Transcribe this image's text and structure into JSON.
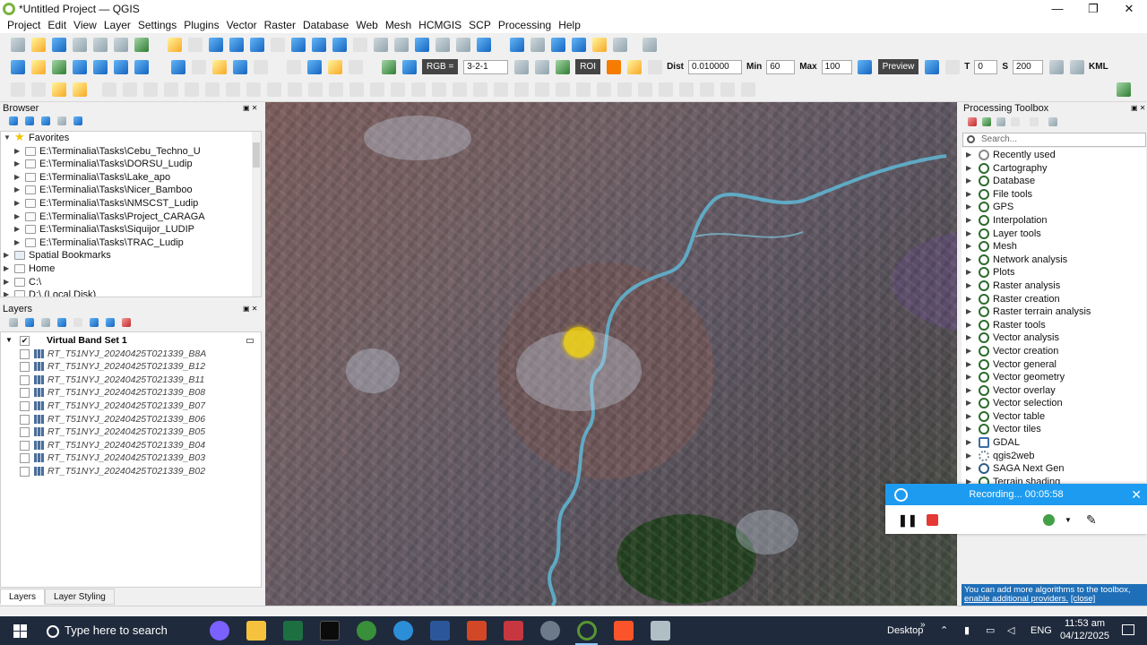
{
  "window": {
    "title": "*Untitled Project — QGIS",
    "minimize": "—",
    "maximize": "❐",
    "close": "✕"
  },
  "menu": [
    "Project",
    "Edit",
    "View",
    "Layer",
    "Settings",
    "Plugins",
    "Vector",
    "Raster",
    "Database",
    "Web",
    "Mesh",
    "HCMGIS",
    "SCP",
    "Processing",
    "Help"
  ],
  "scp_toolbar": {
    "rgb_label": "RGB =",
    "rgb_value": "3-2-1",
    "roi_label": "ROI",
    "dist_label": "Dist",
    "dist_value": "0.010000",
    "min_label": "Min",
    "min_value": "60",
    "max_label": "Max",
    "max_value": "100",
    "preview_label": "Preview",
    "t_label": "T",
    "t_value": "0",
    "s_label": "S",
    "s_value": "200",
    "kml_label": "KML"
  },
  "browser": {
    "title": "Browser",
    "items": [
      {
        "label": "Favorites",
        "level": 0,
        "icon": "star-icon",
        "expanded": true
      },
      {
        "label": "E:\\Terminalia\\Tasks\\Cebu_Techno_U",
        "level": 1,
        "icon": "folder-icon"
      },
      {
        "label": "E:\\Terminalia\\Tasks\\DORSU_Ludip",
        "level": 1,
        "icon": "folder-icon"
      },
      {
        "label": "E:\\Terminalia\\Tasks\\Lake_apo",
        "level": 1,
        "icon": "folder-icon"
      },
      {
        "label": "E:\\Terminalia\\Tasks\\Nicer_Bamboo",
        "level": 1,
        "icon": "folder-icon"
      },
      {
        "label": "E:\\Terminalia\\Tasks\\NMSCST_Ludip",
        "level": 1,
        "icon": "folder-icon"
      },
      {
        "label": "E:\\Terminalia\\Tasks\\Project_CARAGA",
        "level": 1,
        "icon": "folder-icon"
      },
      {
        "label": "E:\\Terminalia\\Tasks\\Siquijor_LUDIP",
        "level": 1,
        "icon": "folder-icon"
      },
      {
        "label": "E:\\Terminalia\\Tasks\\TRAC_Ludip",
        "level": 1,
        "icon": "folder-icon"
      },
      {
        "label": "Spatial Bookmarks",
        "level": 0,
        "icon": "bookmark-icon"
      },
      {
        "label": "Home",
        "level": 0,
        "icon": "home-icon"
      },
      {
        "label": "C:\\",
        "level": 0,
        "icon": "drive-icon"
      },
      {
        "label": "D:\\ (Local Disk)",
        "level": 0,
        "icon": "drive-icon"
      }
    ]
  },
  "layers": {
    "title": "Layers",
    "items": [
      {
        "label": "Virtual Band Set 1",
        "checked": true,
        "group": true
      },
      {
        "label": "RT_T51NYJ_20240425T021339_B8A",
        "checked": false
      },
      {
        "label": "RT_T51NYJ_20240425T021339_B12",
        "checked": false
      },
      {
        "label": "RT_T51NYJ_20240425T021339_B11",
        "checked": false
      },
      {
        "label": "RT_T51NYJ_20240425T021339_B08",
        "checked": false
      },
      {
        "label": "RT_T51NYJ_20240425T021339_B07",
        "checked": false
      },
      {
        "label": "RT_T51NYJ_20240425T021339_B06",
        "checked": false
      },
      {
        "label": "RT_T51NYJ_20240425T021339_B05",
        "checked": false
      },
      {
        "label": "RT_T51NYJ_20240425T021339_B04",
        "checked": false
      },
      {
        "label": "RT_T51NYJ_20240425T021339_B03",
        "checked": false
      },
      {
        "label": "RT_T51NYJ_20240425T021339_B02",
        "checked": false
      }
    ],
    "tabs": [
      "Layers",
      "Layer Styling"
    ]
  },
  "processing": {
    "title": "Processing Toolbox",
    "search_placeholder": "Search...",
    "items": [
      "Recently used",
      "Cartography",
      "Database",
      "File tools",
      "GPS",
      "Interpolation",
      "Layer tools",
      "Mesh",
      "Network analysis",
      "Plots",
      "Raster analysis",
      "Raster creation",
      "Raster terrain analysis",
      "Raster tools",
      "Vector analysis",
      "Vector creation",
      "Vector general",
      "Vector geometry",
      "Vector overlay",
      "Vector selection",
      "Vector table",
      "Vector tiles",
      "GDAL",
      "qgis2web",
      "SAGA Next Gen",
      "Terrain shading"
    ],
    "info_text": "You can add more algorithms to the toolbox,",
    "info_link": "enable additional providers.",
    "info_close": "[close]"
  },
  "recording": {
    "label": "Recording... 00:05:58",
    "close": "✕"
  },
  "taskbar": {
    "search_placeholder": "Type here to search",
    "apps": [
      {
        "name": "copilot",
        "color": "#7b61ff"
      },
      {
        "name": "file-explorer",
        "color": "#f6c23e"
      },
      {
        "name": "excel",
        "color": "#1d6f42"
      },
      {
        "name": "terminal",
        "color": "#0b0b0b"
      },
      {
        "name": "earth",
        "color": "#3a8f3a"
      },
      {
        "name": "browser",
        "color": "#2c8ed6"
      },
      {
        "name": "word",
        "color": "#2b579a"
      },
      {
        "name": "powerpoint",
        "color": "#d24726"
      },
      {
        "name": "calculator",
        "color": "#c7373f"
      },
      {
        "name": "feather",
        "color": "#6c7a89"
      },
      {
        "name": "qgis",
        "color": "#589632"
      },
      {
        "name": "brave",
        "color": "#fb542b"
      },
      {
        "name": "monitor",
        "color": "#b0bec5"
      }
    ],
    "desktop_label": "Desktop",
    "chevron": "»",
    "language": "ENG",
    "time": "11:53 am",
    "date": "04/12/2025"
  }
}
